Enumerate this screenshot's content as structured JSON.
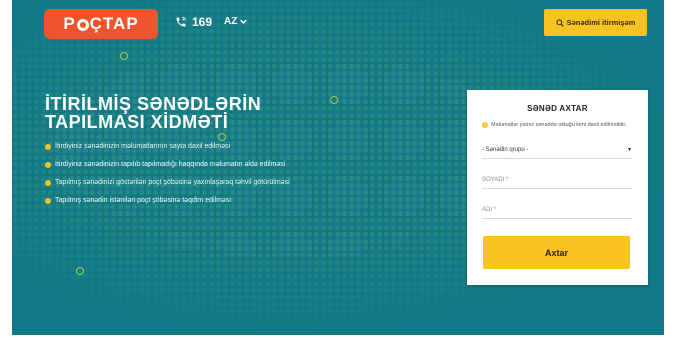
{
  "header": {
    "logo_text_1": "P",
    "logo_text_2": "ÇTAP",
    "phone_icon": "phone-icon",
    "phone_number": "169",
    "language": "AZ",
    "lost_doc_button": "Sənədimi itirmişəm"
  },
  "hero": {
    "title_line1": "İTİRİLMİŞ SƏNƏDLƏRİN",
    "title_line2": "TAPILMASI XİDMƏTİ",
    "features": [
      "İtirdiyiniz sənədinizin məlumatlarının sayta daxil edilməsi",
      "İtirdiyiniz sənədinizin tapılıb tapılmadığı haqqında məlumatın əldə edilməsi",
      "Tapılmış sənədinizi göstərilən poçt şöbəsinə yaxınlaşaraq təhvil götürülməsi",
      "Tapılmış sənədin istənilən poçt şöbəsinə təqdim edilməsi"
    ]
  },
  "search_form": {
    "title": "SƏNƏD AXTAR",
    "info": "Məlumatlar yalnız sənəddə olduğu kimi daxil edilməlidir.",
    "group_select": "- Sənədin qrupu -",
    "surname_placeholder": "SOYADI *",
    "name_placeholder": "ADI *",
    "submit": "Axtar"
  },
  "colors": {
    "background": "#127a86",
    "accent": "#f7c321",
    "brand": "#f0542c"
  }
}
